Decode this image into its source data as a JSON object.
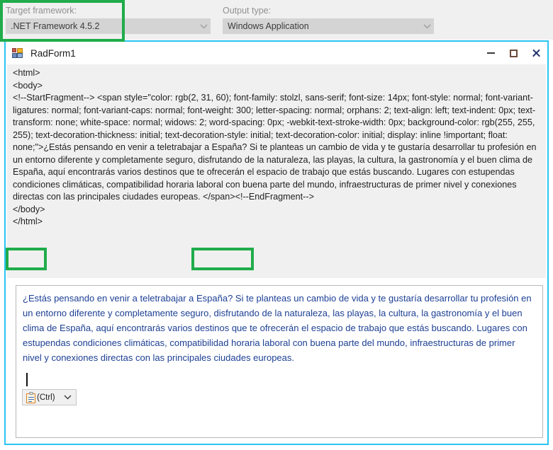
{
  "vs_properties": {
    "target_framework": {
      "label": "Target framework:",
      "value": ".NET Framework 4.5.2",
      "arrow_icon": "chevron-down-icon"
    },
    "output_type": {
      "label": "Output type:",
      "value": "Windows Application",
      "arrow_icon": "chevron-down-icon"
    }
  },
  "annotations": {
    "accent_color": "#20ac4b",
    "boxes": [
      {
        "name": "target-framework-combo"
      },
      {
        "name": "estas-word"
      },
      {
        "name": "espana-word"
      }
    ]
  },
  "window": {
    "title": "RadForm1",
    "icon": "form-designer-icon",
    "border_color": "#2bc4f3",
    "controls": {
      "minimize": "minimize-icon",
      "maximize": "maximize-icon",
      "close": "close-icon"
    }
  },
  "html_source": {
    "text": "<html>\n<body>\n<!--StartFragment--> <span style=\"color: rgb(2, 31, 60); font-family: stolzl, sans-serif; font-size: 14px; font-style: normal; font-variant-ligatures: normal; font-variant-caps: normal; font-weight: 300; letter-spacing: normal; orphans: 2; text-align: left; text-indent: 0px; text-transform: none; white-space: normal; widows: 2; word-spacing: 0px; -webkit-text-stroke-width: 0px; background-color: rgb(255, 255, 255); text-decoration-thickness: initial; text-decoration-style: initial; text-decoration-color: initial; display: inline !important; float: none;\">¿Estás pensando en venir a teletrabajar a España? Si te planteas un cambio de vida y te gustaría desarrollar tu profesión en un entorno diferente y completamente seguro, disfrutando de la naturaleza, las playas, la cultura, la gastronomía y el buen clima de España, aquí encontrarás varios destinos que te ofrecerán el espacio de trabajo que estás buscando. Lugares con estupendas condiciones climáticas, compatibilidad horaria laboral con buena parte del mundo, infraestructuras de primer nivel y conexiones directas con las principales ciudades europeas. </span><!--EndFragment-->\n</body>\n</html>"
  },
  "editor": {
    "text_color": "#1c3f94",
    "content": "¿Estás pensando en venir a teletrabajar a España? Si te planteas un cambio de vida y te gustaría desarrollar tu profesión en un entorno diferente y completamente seguro, disfrutando de la naturaleza, las playas, la cultura, la gastronomía y el buen clima de España, aquí encontrarás varios destinos que te ofrecerán el espacio de trabajo que estás buscando. Lugares con estupendas condiciones climáticas, compatibilidad horaria laboral con buena parte del mundo, infraestructuras de primer nivel y conexiones directas con las principales ciudades europeas.",
    "paste_options": {
      "icon": "clipboard-icon",
      "label": "(Ctrl)",
      "chevron": "chevron-down-icon"
    }
  }
}
